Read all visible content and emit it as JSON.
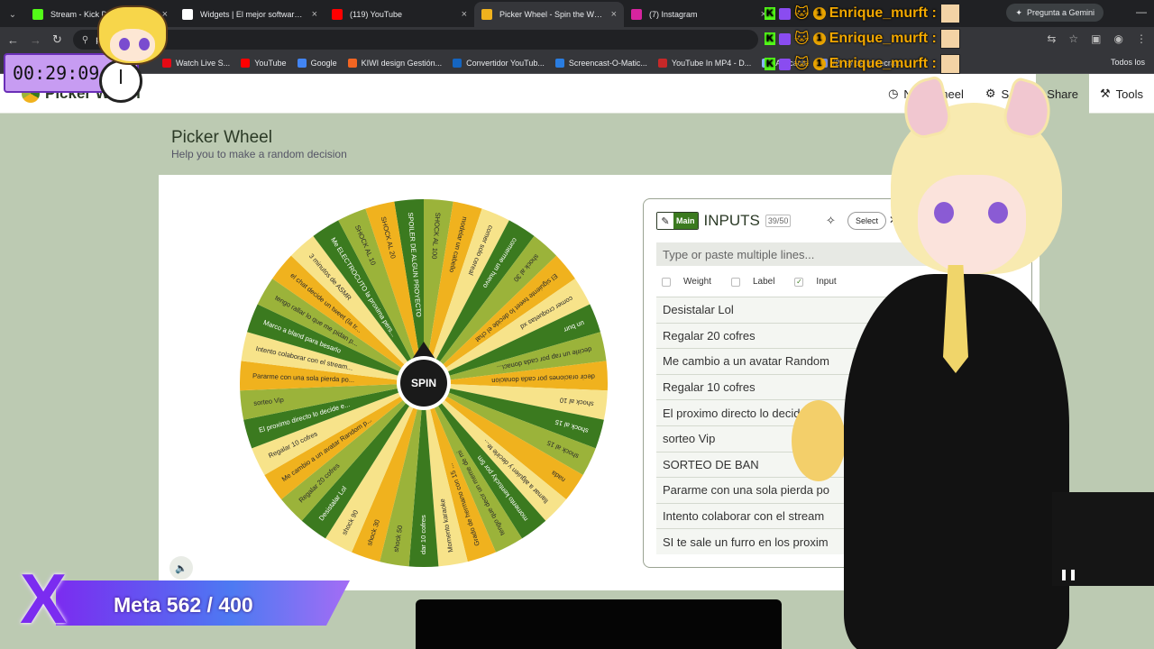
{
  "browser": {
    "tabs": [
      {
        "title": "Stream - Kick Dashboard",
        "color": "#53fc18",
        "active": false
      },
      {
        "title": "Widgets | El mejor software para",
        "color": "#ffffff",
        "active": false
      },
      {
        "title": "(119) YouTube",
        "color": "#ff0000",
        "active": false
      },
      {
        "title": "Picker Wheel - Spin the Wheel",
        "color": "#f0b21e",
        "active": true
      },
      {
        "title": "(7) Instagram",
        "color": "#d6249f",
        "active": false
      }
    ],
    "gemini_label": "Pregunta a Gemini",
    "address": "pi",
    "bookmarks": [
      {
        "label": "Watch Live S...",
        "color": "#e50914"
      },
      {
        "label": "YouTube",
        "color": "#ff0000"
      },
      {
        "label": "Google",
        "color": "#4285f4"
      },
      {
        "label": "KIWI design Gestión...",
        "color": "#f26522"
      },
      {
        "label": "Convertidor YouTub...",
        "color": "#1565c0"
      },
      {
        "label": "Screencast-O-Matic...",
        "color": "#2a7de1"
      },
      {
        "label": "YouTube In MP4 - D...",
        "color": "#c62828"
      },
      {
        "label": "Aplicacio",
        "color": "#8ab4f8"
      },
      {
        "label": "(2) sv de minecraft...",
        "color": "#7289da"
      }
    ],
    "bookmarks_right": "Todos los"
  },
  "site": {
    "logo_text": "Picker Wheel",
    "nav": [
      {
        "icon": "clock-icon",
        "glyph": "◷",
        "label": "New Wheel"
      },
      {
        "icon": "gear-icon",
        "glyph": "⚙",
        "label": "Se..."
      },
      {
        "icon": "share-icon",
        "glyph": "",
        "label": "Share"
      },
      {
        "icon": "tools-icon",
        "glyph": "⚒",
        "label": "Tools"
      }
    ]
  },
  "page": {
    "title": "Picker Wheel",
    "subtitle": "Help you to make a random decision",
    "spin_label": "SPIN"
  },
  "wheel": {
    "colors": [
      "#3b7a1f",
      "#9bb33a",
      "#f0b21e",
      "#f7e38a"
    ],
    "segments": [
      "SPOILER DE ALGUN PROYECTO",
      "SHOCK AL 100",
      "modelar un cabello",
      "comer solo cereal",
      "comerme un huevo",
      "shock al 30",
      "El siguiente tweet lo decide el chat",
      "comer croquetas xd",
      "un burr",
      "decirle un rap por cada donaci...",
      "decir oraciones por cada donacion",
      "shock al 10",
      "shock al 15",
      "shock al 15",
      "nada",
      "llamar a alguien y decirle te...",
      "momento kentucky por 5m",
      "tengo que decir un meme de mi",
      "Grado de hermano con 15 ...",
      "Momento karaoke",
      "dar 10 cofres",
      "shock 50",
      "shock 30",
      "shock 90",
      "Desistalar Lol",
      "Regalar 20 cofres",
      "Me cambio a un avatar Random p...",
      "Regalar 10 cofres",
      "El proximo directo lo decide e...",
      "sorteo Vip",
      "Pararme con una sola pierda po...",
      "Intento colaborar con el stream...",
      "Marco a bland para besarlo",
      "tengo rallar lo que me pidan p...",
      "el chat decide un tweet (la tr...",
      "3 minutos de ASMR",
      "Me ELECTROCUTO la proxima pers...",
      "SHOCK AL 10",
      "SHOCK AL 20"
    ]
  },
  "inputs": {
    "badge_label": "Main",
    "title": "INPUTS",
    "count": "39/50",
    "select_label": "Select",
    "placeholder": "Type or paste multiple lines...",
    "options": [
      {
        "label": "Weight",
        "checked": false
      },
      {
        "label": "Label",
        "checked": false
      },
      {
        "label": "Input",
        "checked": true
      }
    ],
    "items": [
      "Desistalar Lol",
      "Regalar 20 cofres",
      "Me cambio a un avatar Random",
      "Regalar 10 cofres",
      "El proximo directo lo decide",
      "sorteo Vip",
      "SORTEO DE BAN",
      "Pararme con una sola pierda po",
      "Intento colaborar con el stream",
      "SI te sale un furro en los proxim"
    ]
  },
  "overlay": {
    "timer": "00:29:09",
    "chat": [
      {
        "user": "Enrique_murft :"
      },
      {
        "user": "Enrique_murft :"
      },
      {
        "user": "Enrique_murft :"
      }
    ],
    "goal_label": "Meta 562 / 400",
    "goal_current": 562,
    "goal_target": 400
  }
}
